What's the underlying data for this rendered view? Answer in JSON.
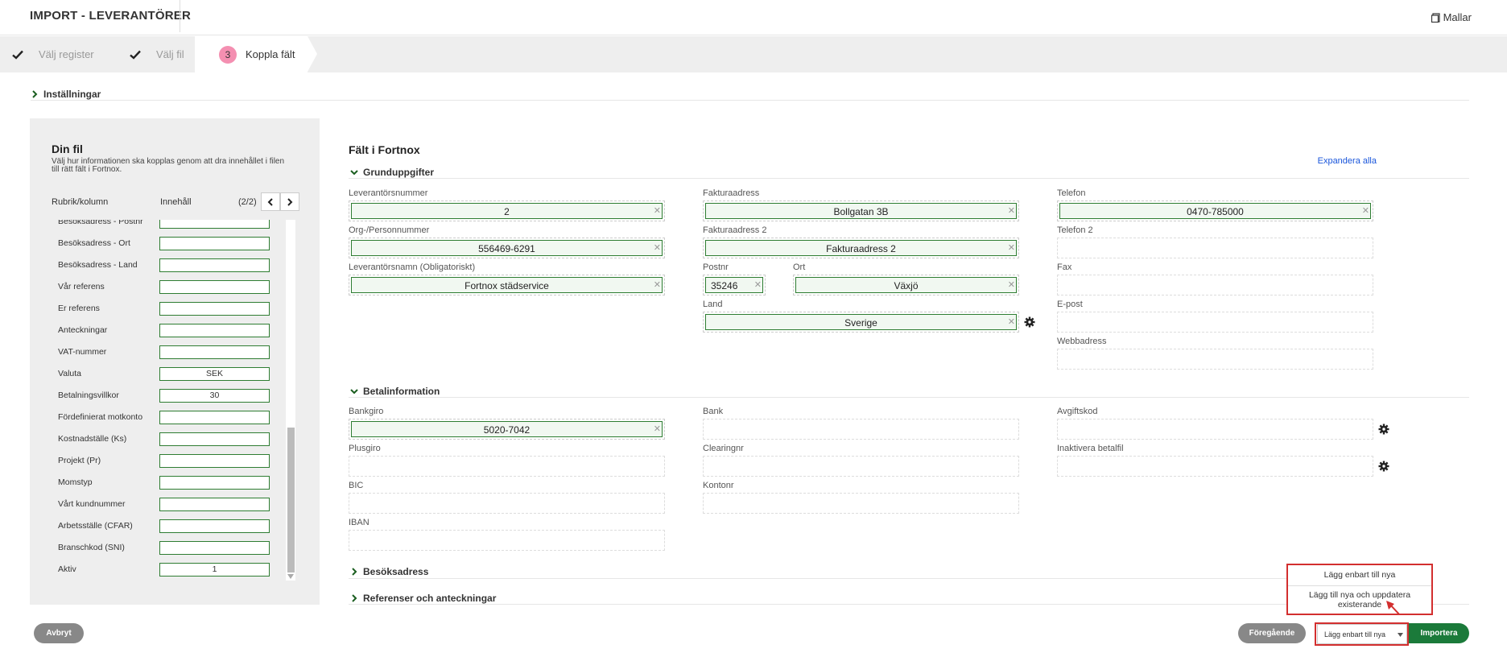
{
  "header": {
    "title": "IMPORT - LEVERANTÖRER",
    "templates_label": "Mallar"
  },
  "steps": [
    {
      "label": "Välj register",
      "state": "done"
    },
    {
      "label": "Välj fil",
      "state": "done"
    },
    {
      "number": "3",
      "label": "Koppla fält",
      "state": "active"
    }
  ],
  "settings": {
    "label": "Inställningar"
  },
  "file_panel": {
    "title": "Din fil",
    "description": "Välj hur informationen ska kopplas genom att dra innehållet i filen till rätt fält i Fortnox.",
    "col_header": "Rubrik/kolumn",
    "content_header": "Innehåll",
    "page_indicator": "(2/2)",
    "rows": [
      {
        "label": "Besöksadress - Postnr",
        "value": ""
      },
      {
        "label": "Besöksadress - Ort",
        "value": ""
      },
      {
        "label": "Besöksadress - Land",
        "value": ""
      },
      {
        "label": "Vår referens",
        "value": ""
      },
      {
        "label": "Er referens",
        "value": ""
      },
      {
        "label": "Anteckningar",
        "value": ""
      },
      {
        "label": "VAT-nummer",
        "value": ""
      },
      {
        "label": "Valuta",
        "value": "SEK"
      },
      {
        "label": "Betalningsvillkor",
        "value": "30"
      },
      {
        "label": "Fördefinierat motkonto",
        "value": ""
      },
      {
        "label": "Kostnadställe (Ks)",
        "value": ""
      },
      {
        "label": "Projekt (Pr)",
        "value": ""
      },
      {
        "label": "Momstyp",
        "value": ""
      },
      {
        "label": "Vårt kundnummer",
        "value": ""
      },
      {
        "label": "Arbetsställe (CFAR)",
        "value": ""
      },
      {
        "label": "Branschkod (SNI)",
        "value": ""
      },
      {
        "label": "Aktiv",
        "value": "1"
      }
    ]
  },
  "fortnox": {
    "title": "Fält i Fortnox",
    "expand_all": "Expandera alla",
    "sections": {
      "basic": "Grunduppgifter",
      "payment": "Betalinformation",
      "visit": "Besöksadress",
      "refs": "Referenser och anteckningar"
    },
    "fields": {
      "supplier_no": {
        "label": "Leverantörsnummer",
        "value": "2"
      },
      "org_no": {
        "label": "Org-/Personnummer",
        "value": "556469-6291"
      },
      "supplier_name": {
        "label": "Leverantörsnamn (Obligatoriskt)",
        "value": "Fortnox städservice"
      },
      "invoice_addr": {
        "label": "Fakturaadress",
        "value": "Bollgatan 3B"
      },
      "invoice_addr2": {
        "label": "Fakturaadress 2",
        "value": "Fakturaadress 2"
      },
      "postnr": {
        "label": "Postnr",
        "value": "35246"
      },
      "city": {
        "label": "Ort",
        "value": "Växjö"
      },
      "country": {
        "label": "Land",
        "value": "Sverige"
      },
      "phone": {
        "label": "Telefon",
        "value": "0470-785000"
      },
      "phone2": {
        "label": "Telefon 2",
        "value": ""
      },
      "fax": {
        "label": "Fax",
        "value": ""
      },
      "email": {
        "label": "E-post",
        "value": ""
      },
      "web": {
        "label": "Webbadress",
        "value": ""
      },
      "bankgiro": {
        "label": "Bankgiro",
        "value": "5020-7042"
      },
      "plusgiro": {
        "label": "Plusgiro",
        "value": ""
      },
      "bic": {
        "label": "BIC",
        "value": ""
      },
      "iban": {
        "label": "IBAN",
        "value": ""
      },
      "bank": {
        "label": "Bank",
        "value": ""
      },
      "clearing": {
        "label": "Clearingnr",
        "value": ""
      },
      "account": {
        "label": "Kontonr",
        "value": ""
      },
      "fee_code": {
        "label": "Avgiftskod",
        "value": ""
      },
      "disable_payfile": {
        "label": "Inaktivera betalfil",
        "value": ""
      }
    }
  },
  "footer": {
    "cancel": "Avbryt",
    "previous": "Föregående",
    "import_mode": "Lägg enbart till nya",
    "import": "Importera",
    "dropdown_options": [
      "Lägg enbart till nya",
      "Lägg till nya och uppdatera existerande"
    ]
  },
  "colors": {
    "accent_green": "#1b7a3a",
    "step_badge": "#f48fb1",
    "highlight_red": "#d32f2f",
    "link_blue": "#1a56db"
  }
}
